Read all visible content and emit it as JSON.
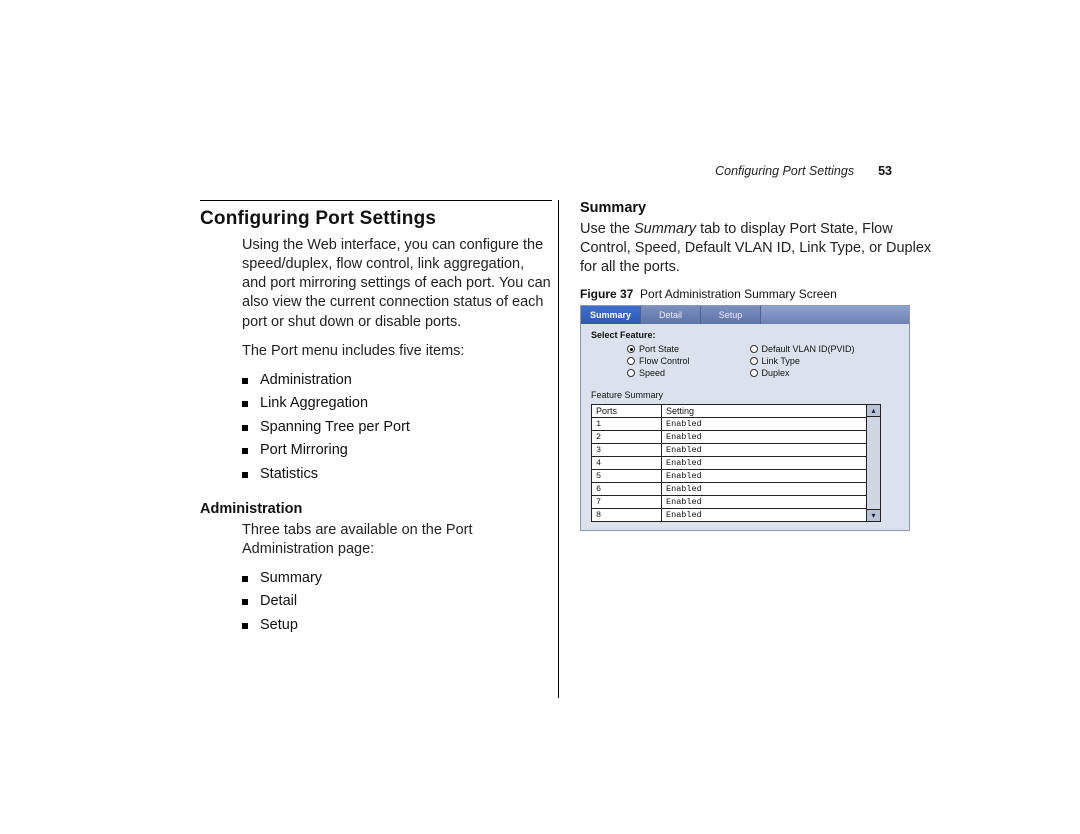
{
  "header": {
    "running_title": "Configuring Port Settings",
    "page_number": "53"
  },
  "left": {
    "h1": "Configuring Port Settings",
    "intro": "Using the Web interface, you can configure the speed/duplex, flow control, link aggregation, and port mirroring settings of each port. You can also view the current connection status of each port or shut down or disable ports.",
    "menu_lead": "The Port menu includes five items:",
    "menu": [
      "Administration",
      "Link Aggregation",
      "Spanning Tree per Port",
      "Port Mirroring",
      "Statistics"
    ],
    "admin_h": "Administration",
    "admin_lead": "Three tabs are available on the Port Administration page:",
    "tabs": [
      "Summary",
      "Detail",
      "Setup"
    ]
  },
  "right": {
    "sub": "Summary",
    "para_pre": "Use the ",
    "para_em": "Summary",
    "para_post": " tab to display Port State, Flow Control, Speed, Default VLAN ID, Link Type, or Duplex for all the ports.",
    "fig_label": "Figure 37",
    "fig_caption": "Port Administration Summary Screen"
  },
  "screenshot": {
    "tabs": {
      "active": "Summary",
      "others": [
        "Detail",
        "Setup"
      ]
    },
    "select_feature_label": "Select Feature:",
    "radios_left": [
      {
        "label": "Port State",
        "selected": true
      },
      {
        "label": "Flow Control",
        "selected": false
      },
      {
        "label": "Speed",
        "selected": false
      }
    ],
    "radios_right": [
      {
        "label": "Default VLAN ID(PVID)",
        "selected": false
      },
      {
        "label": "Link Type",
        "selected": false
      },
      {
        "label": "Duplex",
        "selected": false
      }
    ],
    "feature_summary_label": "Feature Summary",
    "table": {
      "headers": [
        "Ports",
        "Setting"
      ],
      "rows": [
        {
          "port": "1",
          "setting": "Enabled"
        },
        {
          "port": "2",
          "setting": "Enabled"
        },
        {
          "port": "3",
          "setting": "Enabled"
        },
        {
          "port": "4",
          "setting": "Enabled"
        },
        {
          "port": "5",
          "setting": "Enabled"
        },
        {
          "port": "6",
          "setting": "Enabled"
        },
        {
          "port": "7",
          "setting": "Enabled"
        },
        {
          "port": "8",
          "setting": "Enabled"
        }
      ]
    },
    "scroll": {
      "up": "▴",
      "down": "▾"
    }
  }
}
